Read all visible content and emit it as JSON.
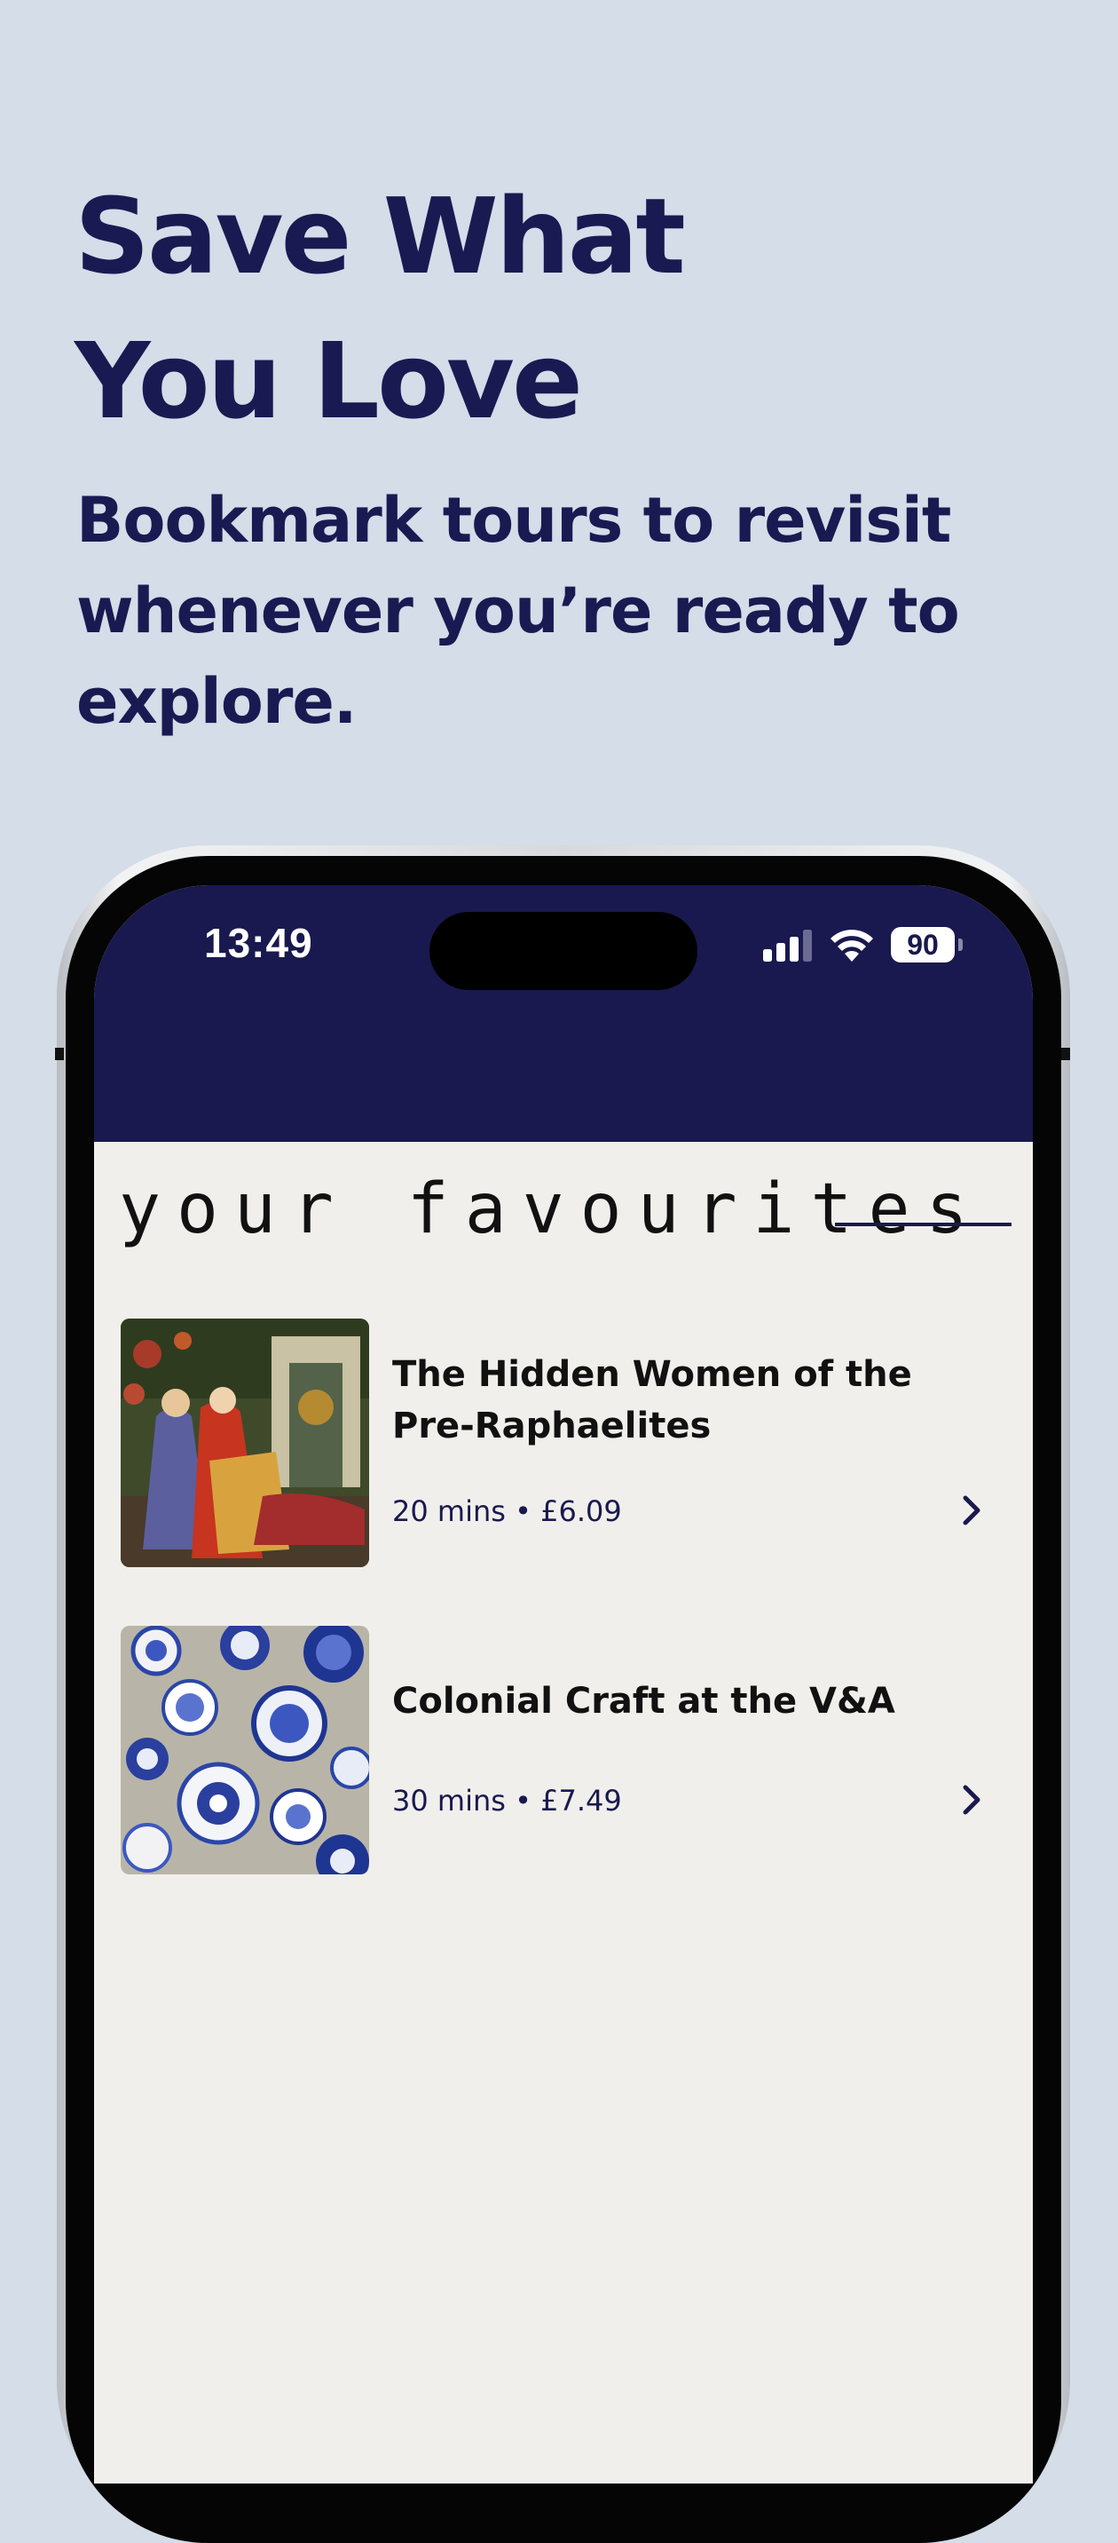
{
  "promo": {
    "headline_line1": "Save What",
    "headline_line2": "You Love",
    "subline": "Bookmark tours to revisit whenever you’re ready to explore."
  },
  "status_bar": {
    "time": "13:49",
    "battery": "90",
    "icons": [
      "cellular-signal-icon",
      "wifi-icon",
      "battery-icon"
    ]
  },
  "screen": {
    "section_title": "your favourites",
    "favourites": [
      {
        "title": "The Hidden Women of the Pre-Raphaelites",
        "duration": "20 mins",
        "separator": "•",
        "price": "£6.09",
        "thumbnail": "painting-thumbnail",
        "action_icon": "chevron-right-icon"
      },
      {
        "title": "Colonial Craft at the V&A",
        "duration": "30 mins",
        "separator": "•",
        "price": "£7.49",
        "thumbnail": "porcelain-plates-thumbnail",
        "action_icon": "chevron-right-icon"
      }
    ]
  },
  "colors": {
    "page_background": "#d4dde8",
    "brand_navy": "#19194f",
    "screen_background": "#f0efeb",
    "text_dark": "#111111"
  }
}
